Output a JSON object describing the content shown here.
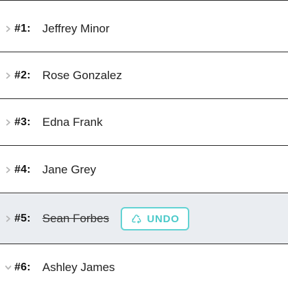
{
  "list": {
    "rows": [
      {
        "num": "#1:",
        "name": "Jeffrey Minor",
        "chevron": "chevron-right-icon"
      },
      {
        "num": "#2:",
        "name": "Rose Gonzalez",
        "chevron": "chevron-right-icon"
      },
      {
        "num": "#3:",
        "name": "Edna Frank",
        "chevron": "chevron-right-icon"
      },
      {
        "num": "#4:",
        "name": "Jane Grey",
        "chevron": "chevron-right-icon"
      },
      {
        "num": "#5:",
        "name": "Sean Forbes",
        "chevron": "chevron-right-icon",
        "deleted": true,
        "undo_label": "UNDO",
        "undo_icon": "recycle-icon"
      },
      {
        "num": "#6:",
        "name": "Ashley James",
        "chevron": "chevron-down-icon"
      }
    ]
  },
  "colors": {
    "accent": "#4ccaca",
    "deleted_row_bg": "#eaedf1",
    "divider": "#2a2a2a"
  }
}
